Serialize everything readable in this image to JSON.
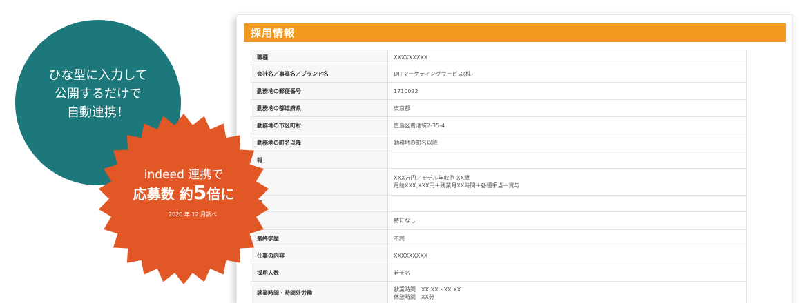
{
  "form": {
    "title": "採用情報",
    "rows": [
      {
        "label": "職種",
        "value": "XXXXXXXXX"
      },
      {
        "label": "会社名／事業名／ブランド名",
        "value": "DITマーケティングサービス(株)"
      },
      {
        "label": "勤務地の郵便番号",
        "value": "1710022"
      },
      {
        "label": "勤務地の都道府県",
        "value": "東京都"
      },
      {
        "label": "勤務地の市区町村",
        "value": "豊島区南池袋2-35-4"
      },
      {
        "label": "勤務地の町名以降",
        "value": "勤務地の町名以降"
      },
      {
        "label": "報",
        "value": ""
      },
      {
        "label": "",
        "value": "XXX万円／モデル年収例 XX歳",
        "value2": "月給XXX,XXX円＋残業月XX時間＋各種手当＋賞与"
      },
      {
        "label": "態",
        "value": ""
      },
      {
        "label": "",
        "value": "特になし"
      },
      {
        "label": "最終学歴",
        "value": "不問"
      },
      {
        "label": "仕事の内容",
        "value": "XXXXXXXXX"
      },
      {
        "label": "採用人数",
        "value": "若干名"
      },
      {
        "label": "就業時間・時間外労働",
        "value": "就業時間　XX:XX〜XX:XX",
        "value2": "休憩時間　XX分"
      }
    ]
  },
  "promo": {
    "teal_lines": [
      "ひな型に入力して",
      "公開するだけで",
      "自動連携！"
    ],
    "burst_line1": "indeed 連携で",
    "burst_line2_a": "応募数 約",
    "burst_line2_num": "5",
    "burst_line2_b": "倍に",
    "burst_note": "2020 年 12 月調べ"
  },
  "colors": {
    "header_orange": "#f39a1e",
    "teal": "#1c787a",
    "burst_orange": "#e15826"
  }
}
